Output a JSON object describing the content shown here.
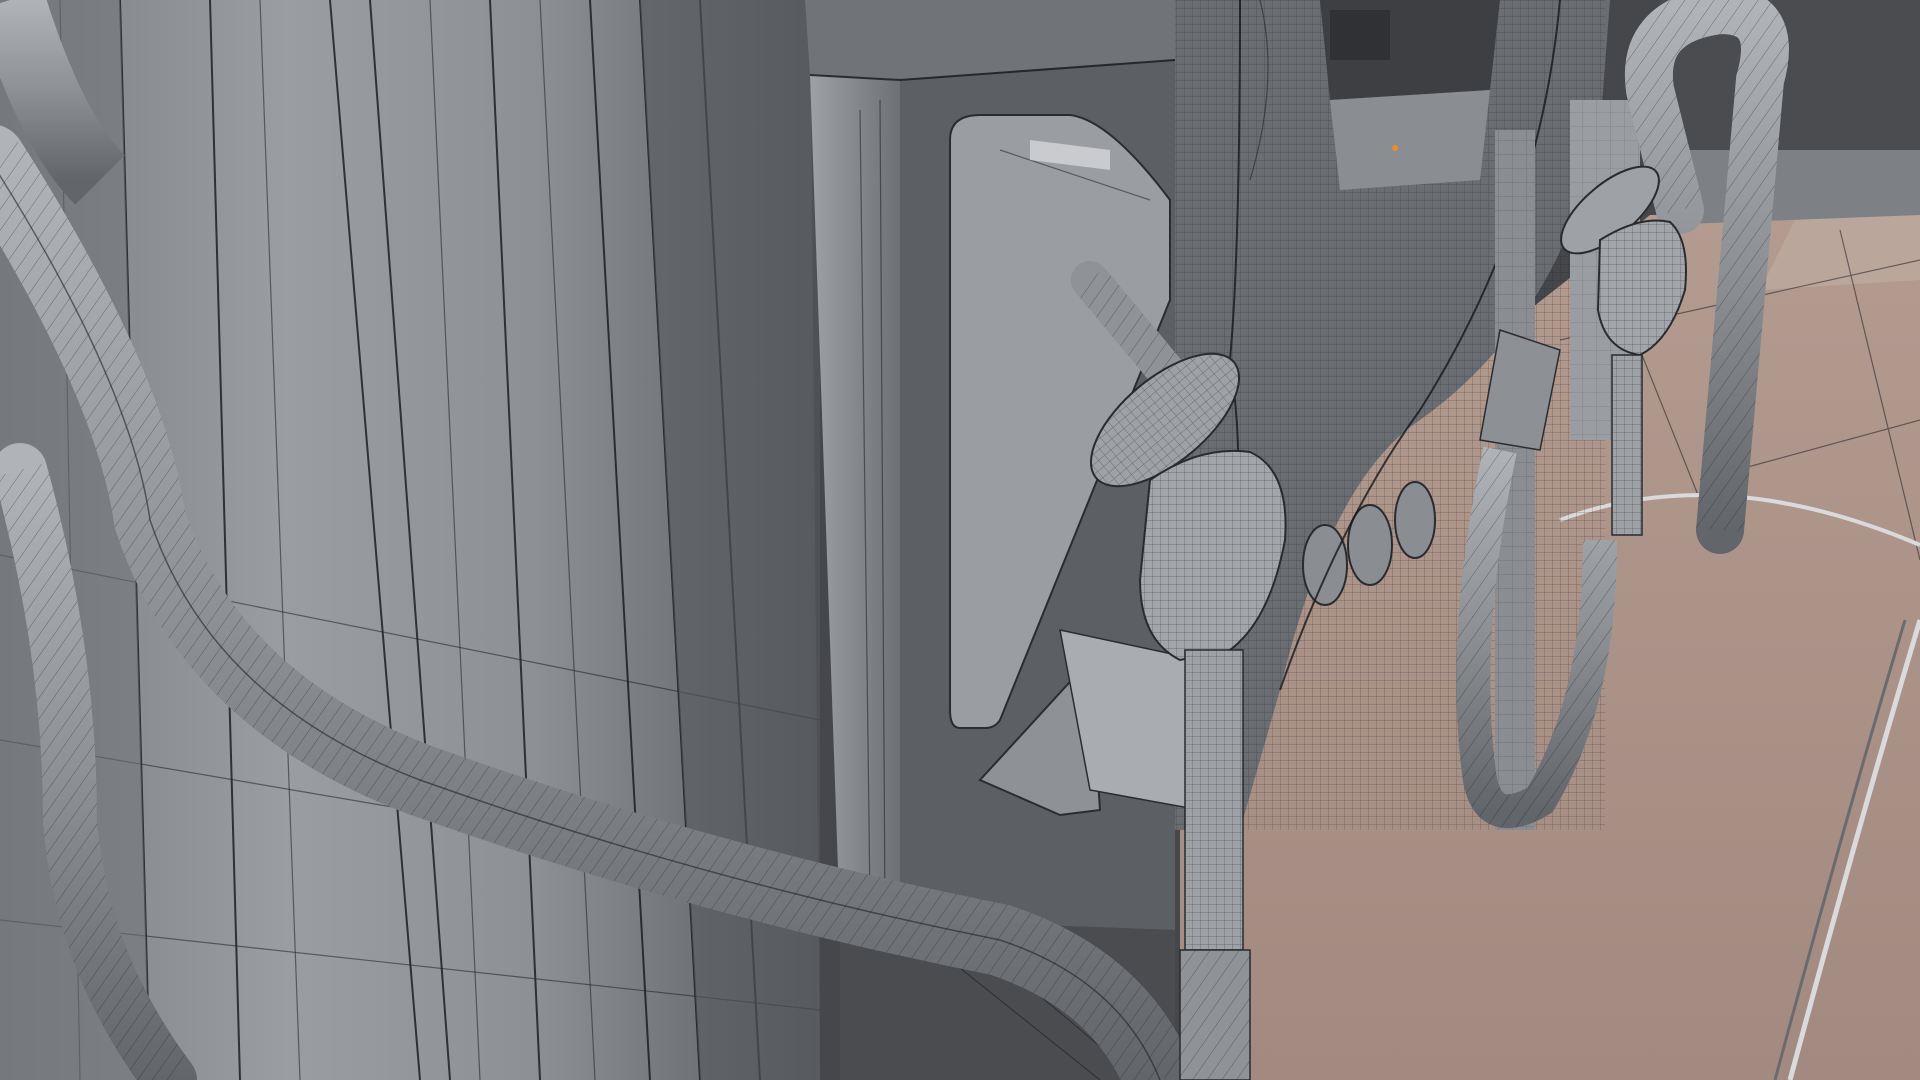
{
  "scene": {
    "render_style": "wireframe-on-shaded",
    "subject": "fuel-pump-3d-model",
    "colors": {
      "wall": "#8a8d92",
      "wall_shadow": "#5d6065",
      "wall_highlight": "#a7aab0",
      "dark_panel": "#3f4145",
      "floor_light": "#e8b788",
      "floor_mid": "#b79a88",
      "floor_shadow": "#9c8880",
      "wire": "#1e1f22",
      "accent_orange": "#f08a2c",
      "hose": "#9a9da2"
    },
    "objects": [
      {
        "name": "pump-body",
        "icon": "cylinder-icon"
      },
      {
        "name": "hose-left",
        "icon": "hose-icon"
      },
      {
        "name": "hose-right",
        "icon": "hose-icon"
      },
      {
        "name": "nozzle-left",
        "icon": "nozzle-icon"
      },
      {
        "name": "nozzle-right",
        "icon": "nozzle-icon"
      },
      {
        "name": "control-panel",
        "icon": "panel-icon"
      },
      {
        "name": "guard-rail",
        "icon": "rail-icon"
      }
    ]
  }
}
